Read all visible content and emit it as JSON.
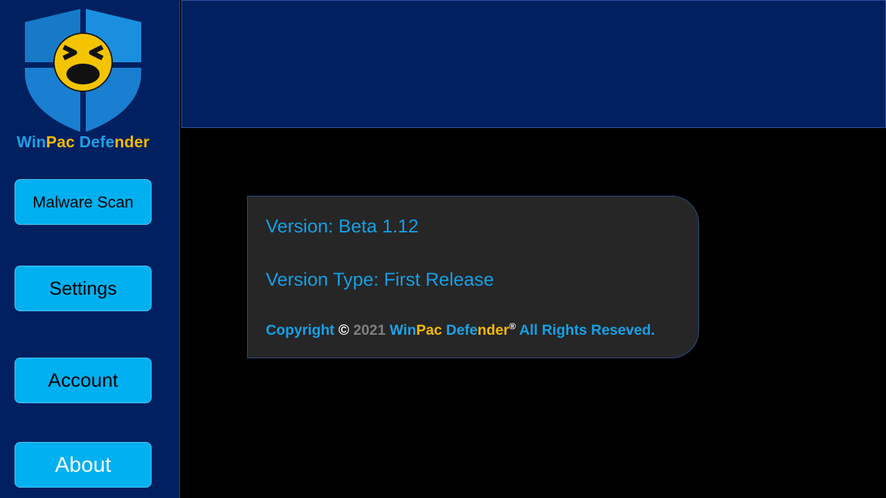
{
  "app": {
    "brand_parts": [
      "Win",
      "Pac",
      " Defe",
      "nder"
    ],
    "brand_colors": {
      "blue": "#1ea0e6",
      "gold": "#f5b800"
    }
  },
  "sidebar": {
    "logo_icon": "shield-face-logo",
    "buttons": [
      {
        "label": "Malware Scan",
        "active": false
      },
      {
        "label": "Settings",
        "active": false
      },
      {
        "label": "Account",
        "active": false
      },
      {
        "label": "About",
        "active": true
      }
    ]
  },
  "about": {
    "version": "Version: Beta 1.12",
    "version_type": "Version Type: First Release",
    "copyright": {
      "prefix": "Copyright ",
      "symbol": "©",
      "year": " 2021 ",
      "brand_parts": [
        "Win",
        "Pac",
        " Defe",
        "nder"
      ],
      "registered": "®",
      "suffix": " All Rights Reseved."
    }
  },
  "colors": {
    "sidebar_bg": "#002060",
    "button_bg": "#00b0f0",
    "card_bg": "#262626",
    "text_accent": "#14a0e6",
    "content_bg": "#000000"
  }
}
